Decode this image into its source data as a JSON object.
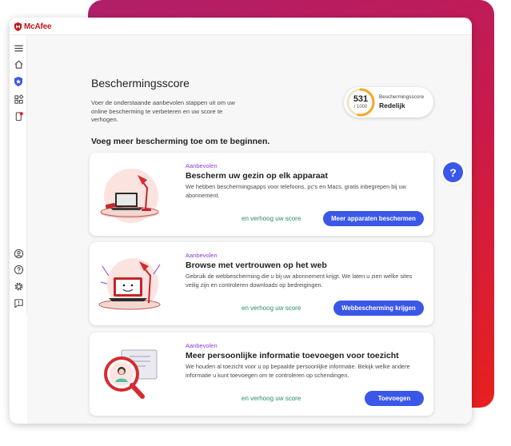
{
  "app": {
    "logo_text": "McAfee"
  },
  "icons": {
    "menu": "hamburger-menu-icon",
    "home": "home-icon",
    "protection": "shield-star-icon",
    "apps": "apps-grid-icon",
    "alerts": "phone-notification-icon",
    "account": "user-icon",
    "help": "question-icon",
    "settings": "gear-icon",
    "feedback": "chat-icon"
  },
  "colors": {
    "accent": "#3a57e8",
    "brand": "#c01818",
    "score_ring": "#f5a623",
    "kicker": "#8c3bd1",
    "link": "#2c8d64"
  },
  "page": {
    "title": "Beschermingsscore",
    "description": "Voer de onderstaande aanbevolen stappen uit om uw online bescherming te verbeteren en uw score te verhogen.",
    "section_title": "Voeg meer bescherming toe om te beginnen."
  },
  "score": {
    "value": "531",
    "max": "/ 1000",
    "fraction": 0.531,
    "label": "Beschermingsscore",
    "status": "Redelijk"
  },
  "cards": [
    {
      "kicker": "Aanbevolen",
      "title": "Bescherm uw gezin op elk apparaat",
      "description": "We hebben beschermingsapps voor telefoons, pc's en Macs, gratis inbegrepen bij uw abonnement.",
      "link": "en verhoog uw score",
      "button": "Meer apparaten beschermen"
    },
    {
      "kicker": "Aanbevolen",
      "title": "Browse met vertrouwen op het web",
      "description": "Gebruik de webbescherming die u bij uw abonnement krijgt. We laten u zien welke sites veilig zijn en controleren downloads op bedreigingen.",
      "link": "en verhoog uw score",
      "button": "Webbescherming krijgen"
    },
    {
      "kicker": "Aanbevolen",
      "title": "Meer persoonlijke informatie toevoegen voor toezicht",
      "description": "We houden al toezicht voor u op bepaalde persoonlijke informatie. Bekijk welke andere informatie u kunt toevoegen om te controleren op schendingen.",
      "link": "en verhoog uw score",
      "button": "Toevoegen"
    }
  ],
  "help_button": {
    "label": "?"
  }
}
